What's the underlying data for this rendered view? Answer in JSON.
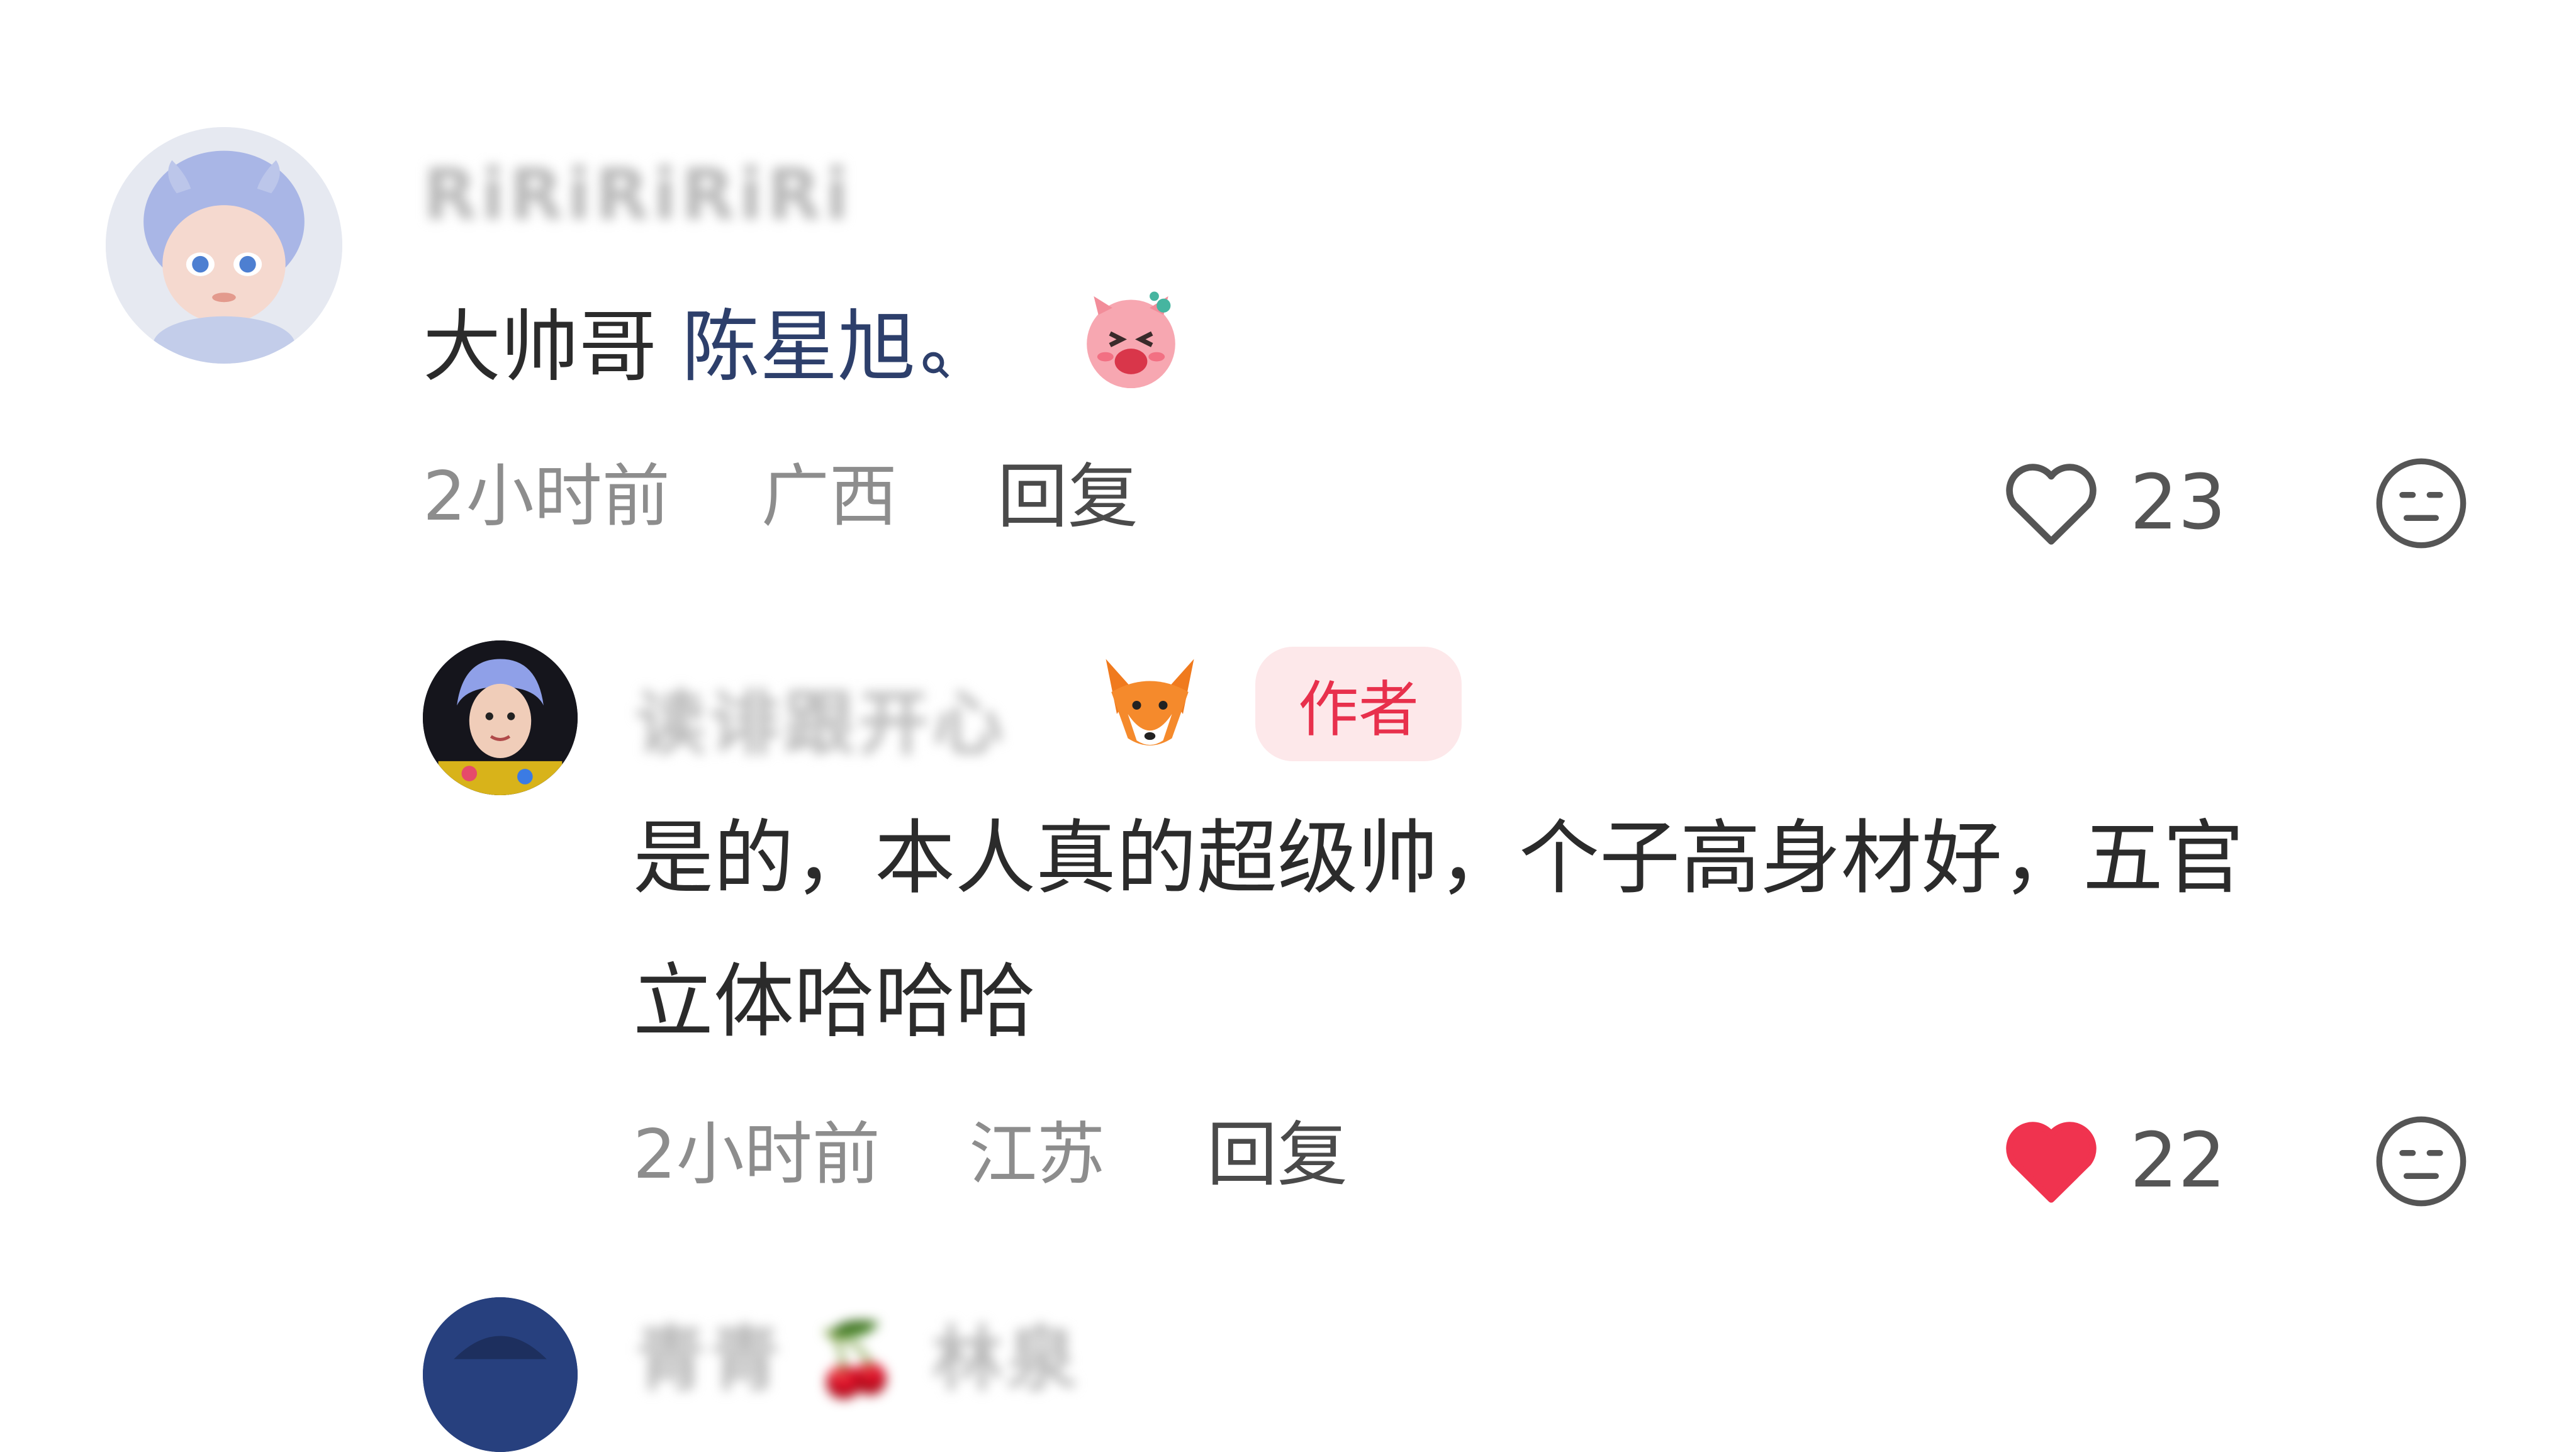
{
  "comments": [
    {
      "username": "RiRiRiRiRi",
      "text_prefix": "大帅哥 ",
      "mention": "陈星旭",
      "emoji": "laughing-pig-emoji",
      "time": "2小时前",
      "location": "广西",
      "reply_label": "回复",
      "likes": "23",
      "liked": false
    },
    {
      "username": "读诽跟开心",
      "badge": "作者",
      "text_line1": "是的，本人真的超级帅，个子高身材好，五官",
      "text_line2": "立体哈哈哈",
      "time": "2小时前",
      "location": "江苏",
      "reply_label": "回复",
      "likes": "22",
      "liked": true
    },
    {
      "username": "青青 🍒 林泉"
    }
  ],
  "colors": {
    "mention": "#2d3f6b",
    "liked_heart": "#f0334f",
    "badge_bg": "#fde8ea",
    "badge_text": "#e8304c",
    "meta_text": "#8d8d8d"
  }
}
